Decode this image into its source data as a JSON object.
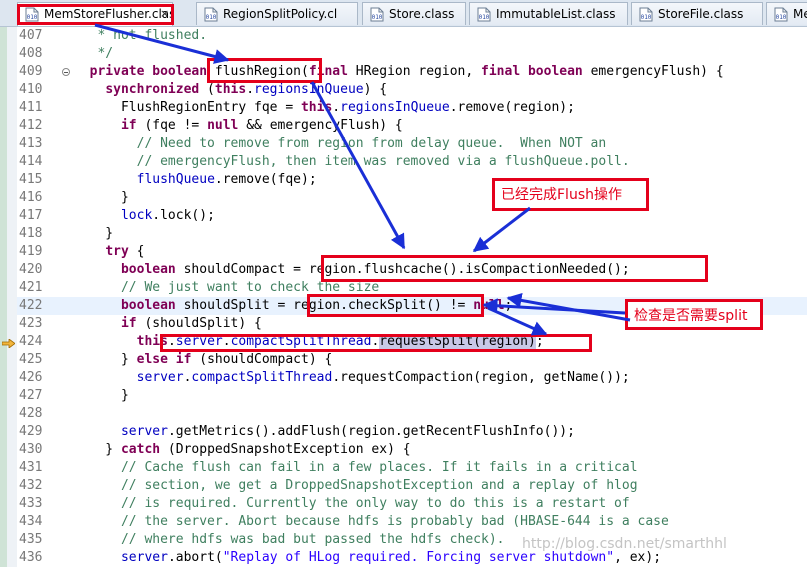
{
  "tabs": [
    {
      "label": "MemStoreFlusher.clas",
      "close": "×",
      "active": true
    },
    {
      "label": "RegionSplitPolicy.cl",
      "close": "",
      "active": false
    },
    {
      "label": "Store.class",
      "close": "",
      "active": false
    },
    {
      "label": "ImmutableList.class",
      "close": "",
      "active": false
    },
    {
      "label": "StoreFile.class",
      "close": "",
      "active": false
    },
    {
      "label": "Mem",
      "close": "",
      "active": false
    }
  ],
  "file_icon_text": "010",
  "editor": {
    "current_line": "424",
    "lines": [
      {
        "n": "407",
        "segs": [
          [
            "   * not flushed.",
            "cm"
          ]
        ]
      },
      {
        "n": "408",
        "segs": [
          [
            "   */",
            "cm"
          ]
        ]
      },
      {
        "n": "409",
        "fold": true,
        "segs": [
          [
            "  ",
            ""
          ],
          [
            "private boolean",
            "kw"
          ],
          [
            " flushRegion(",
            ""
          ],
          [
            "final",
            "kw"
          ],
          [
            " HRegion region, ",
            ""
          ],
          [
            "final boolean",
            "kw"
          ],
          [
            " emergencyFlush) {",
            ""
          ]
        ]
      },
      {
        "n": "410",
        "segs": [
          [
            "    ",
            ""
          ],
          [
            "synchronized",
            "kw"
          ],
          [
            " (",
            ""
          ],
          [
            "this",
            "kw"
          ],
          [
            ".",
            ""
          ],
          [
            "regionsInQueue",
            "fd"
          ],
          [
            ") {",
            ""
          ]
        ]
      },
      {
        "n": "411",
        "segs": [
          [
            "      FlushRegionEntry fqe = ",
            ""
          ],
          [
            "this",
            "kw"
          ],
          [
            ".",
            ""
          ],
          [
            "regionsInQueue",
            "fd"
          ],
          [
            ".remove(region);",
            ""
          ]
        ]
      },
      {
        "n": "412",
        "segs": [
          [
            "      ",
            ""
          ],
          [
            "if",
            "kw"
          ],
          [
            " (fqe != ",
            ""
          ],
          [
            "null",
            "kw"
          ],
          [
            " && emergencyFlush) {",
            ""
          ]
        ]
      },
      {
        "n": "413",
        "segs": [
          [
            "        // Need to remove from region from delay queue.  When NOT an",
            "cm"
          ]
        ]
      },
      {
        "n": "414",
        "segs": [
          [
            "        // emergencyFlush, then item was removed via a flushQueue.poll.",
            "cm"
          ]
        ]
      },
      {
        "n": "415",
        "segs": [
          [
            "        ",
            ""
          ],
          [
            "flushQueue",
            "fd"
          ],
          [
            ".remove(fqe);",
            ""
          ]
        ]
      },
      {
        "n": "416",
        "segs": [
          [
            "      }",
            ""
          ]
        ]
      },
      {
        "n": "417",
        "segs": [
          [
            "      ",
            ""
          ],
          [
            "lock",
            "fd"
          ],
          [
            ".lock();",
            ""
          ]
        ]
      },
      {
        "n": "418",
        "segs": [
          [
            "    }",
            ""
          ]
        ]
      },
      {
        "n": "419",
        "segs": [
          [
            "    ",
            ""
          ],
          [
            "try",
            "kw"
          ],
          [
            " {",
            ""
          ]
        ]
      },
      {
        "n": "420",
        "segs": [
          [
            "      ",
            ""
          ],
          [
            "boolean",
            "kw"
          ],
          [
            " shouldCompact = region.flushcache().isCompactionNeeded();",
            ""
          ]
        ]
      },
      {
        "n": "421",
        "segs": [
          [
            "      // We just want to check the size",
            "cm"
          ]
        ]
      },
      {
        "n": "422",
        "cur": true,
        "segs": [
          [
            "      ",
            ""
          ],
          [
            "boolean",
            "kw"
          ],
          [
            " shouldSplit = region.checkSplit() != ",
            ""
          ],
          [
            "null",
            "kw"
          ],
          [
            ";",
            ""
          ]
        ]
      },
      {
        "n": "423",
        "segs": [
          [
            "      ",
            ""
          ],
          [
            "if",
            "kw"
          ],
          [
            " (shouldSplit) {",
            ""
          ]
        ]
      },
      {
        "n": "424",
        "segs": [
          [
            "        ",
            ""
          ],
          [
            "this",
            "kw"
          ],
          [
            ".",
            ""
          ],
          [
            "server",
            "fd"
          ],
          [
            ".",
            ""
          ],
          [
            "compactSplitThread",
            "fd"
          ],
          [
            ".",
            ""
          ],
          [
            "requestSplit(region)",
            "hl"
          ],
          [
            ";",
            ""
          ]
        ]
      },
      {
        "n": "425",
        "segs": [
          [
            "      } ",
            ""
          ],
          [
            "else if",
            "kw"
          ],
          [
            " (shouldCompact) {",
            ""
          ]
        ]
      },
      {
        "n": "426",
        "segs": [
          [
            "        ",
            ""
          ],
          [
            "server",
            "fd"
          ],
          [
            ".",
            ""
          ],
          [
            "compactSplitThread",
            "fd"
          ],
          [
            ".requestCompaction(region, getName());",
            ""
          ]
        ]
      },
      {
        "n": "427",
        "segs": [
          [
            "      }",
            ""
          ]
        ]
      },
      {
        "n": "428",
        "segs": [
          [
            "",
            ""
          ]
        ]
      },
      {
        "n": "429",
        "segs": [
          [
            "      ",
            ""
          ],
          [
            "server",
            "fd"
          ],
          [
            ".getMetrics().addFlush(region.getRecentFlushInfo());",
            ""
          ]
        ]
      },
      {
        "n": "430",
        "segs": [
          [
            "    } ",
            ""
          ],
          [
            "catch",
            "kw"
          ],
          [
            " (DroppedSnapshotException ex) {",
            ""
          ]
        ]
      },
      {
        "n": "431",
        "segs": [
          [
            "      // Cache flush can fail in a few places. If it fails in a critical",
            "cm"
          ]
        ]
      },
      {
        "n": "432",
        "segs": [
          [
            "      // section, we get a DroppedSnapshotException and a replay of hlog",
            "cm"
          ]
        ]
      },
      {
        "n": "433",
        "segs": [
          [
            "      // is required. Currently the only way to do this is a restart of",
            "cm"
          ]
        ]
      },
      {
        "n": "434",
        "segs": [
          [
            "      // the server. Abort because hdfs is probably bad (HBASE-644 is a case",
            "cm"
          ]
        ]
      },
      {
        "n": "435",
        "segs": [
          [
            "      // where hdfs was bad but passed the hdfs check).",
            "cm"
          ]
        ]
      },
      {
        "n": "436",
        "segs": [
          [
            "      ",
            ""
          ],
          [
            "server",
            "fd"
          ],
          [
            ".abort(",
            ""
          ],
          [
            "\"Replay of HLog required. Forcing server shutdown\"",
            "st"
          ],
          [
            ", ex);",
            ""
          ]
        ]
      }
    ]
  },
  "annotations": {
    "flush_done": "已经完成Flush操作",
    "check_split": "检查是否需要split"
  },
  "watermark": "http://blog.csdn.net/smarthhl",
  "colors": {
    "annotation_red": "#e4001b",
    "arrow_blue": "#1a2fd6",
    "keyword": "#7f0055",
    "comment": "#3f7f5f",
    "field": "#0000c0",
    "string": "#2a00ff",
    "current_line_bg": "#e8f2fe",
    "selection_bg": "#c8c8e6"
  }
}
